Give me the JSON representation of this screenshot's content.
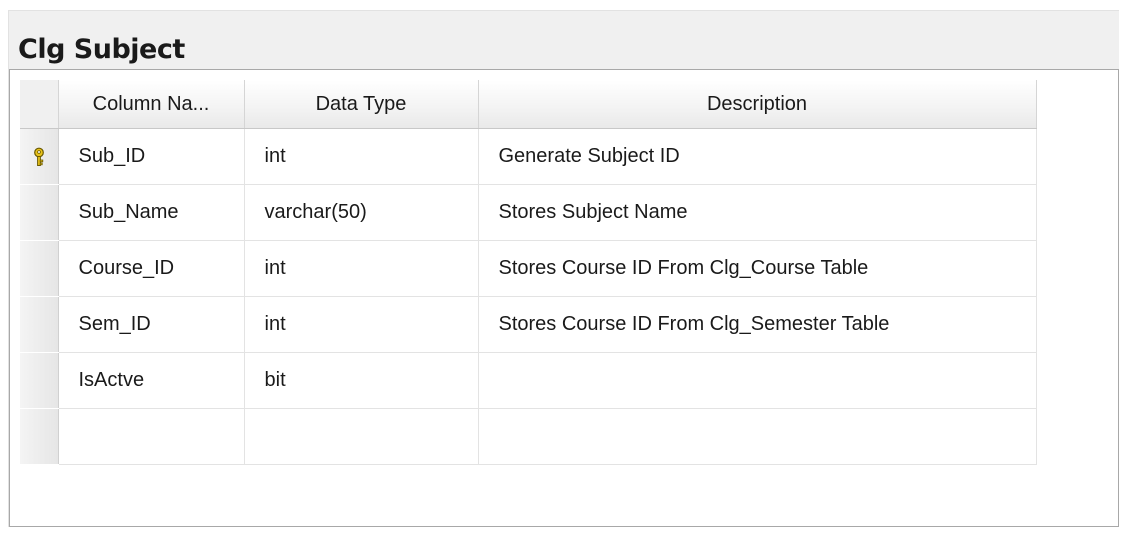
{
  "table": {
    "title": "Clg Subject",
    "columns": [
      "Column Na...",
      "Data Type",
      "Description"
    ],
    "rows": [
      {
        "primary_key": true,
        "column_name": "Sub_ID",
        "data_type": "int",
        "description": "Generate Subject ID"
      },
      {
        "primary_key": false,
        "column_name": "Sub_Name",
        "data_type": "varchar(50)",
        "description": "Stores Subject Name"
      },
      {
        "primary_key": false,
        "column_name": "Course_ID",
        "data_type": "int",
        "description": "Stores Course ID From Clg_Course Table"
      },
      {
        "primary_key": false,
        "column_name": "Sem_ID",
        "data_type": "int",
        "description": "Stores Course ID From Clg_Semester Table"
      },
      {
        "primary_key": false,
        "column_name": "IsActve",
        "data_type": "bit",
        "description": ""
      },
      {
        "primary_key": false,
        "column_name": "",
        "data_type": "",
        "description": ""
      }
    ]
  },
  "icons": {
    "primary_key": "key-icon"
  },
  "colors": {
    "key_icon": "#e8c21a",
    "panel_background": "#f0f0f0",
    "panel_border": "#a8a8a8"
  }
}
